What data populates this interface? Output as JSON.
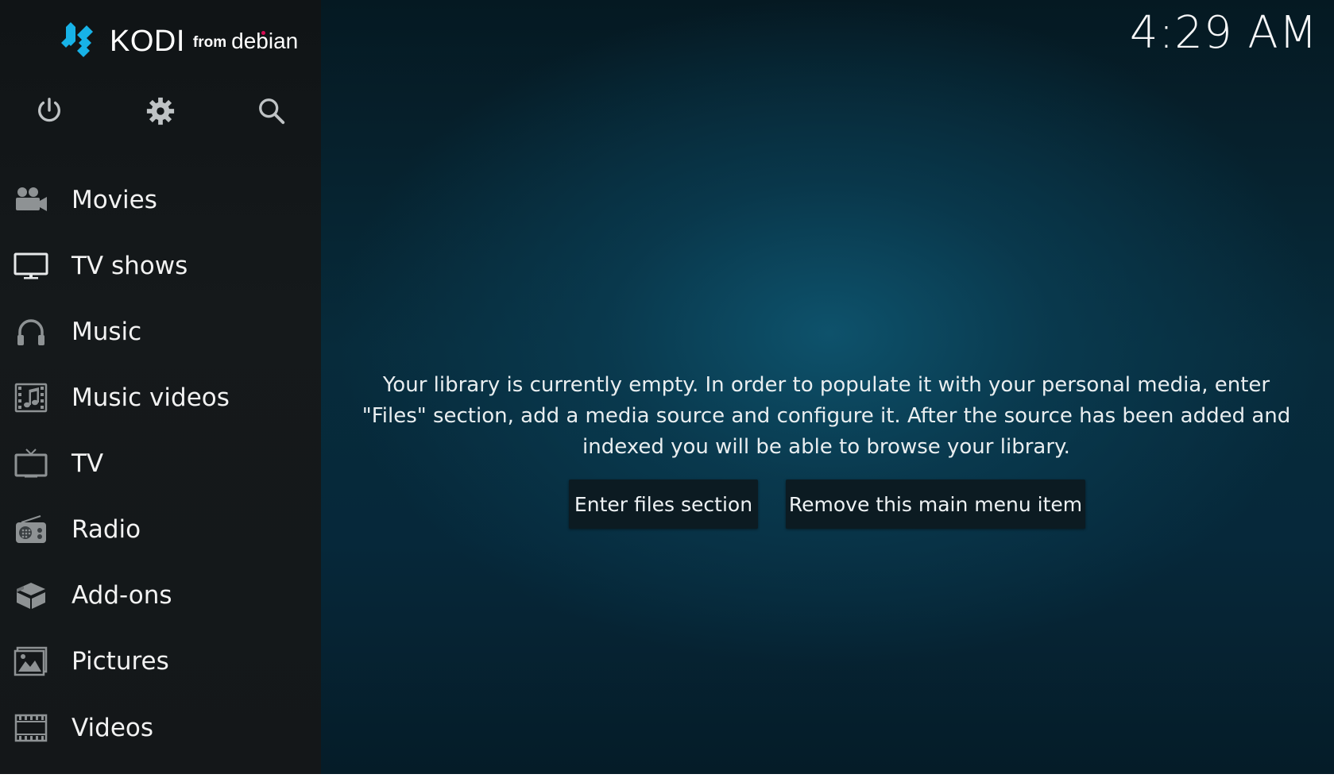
{
  "app": {
    "logo": {
      "brand": "KODI",
      "from": "from",
      "distro": "debian"
    },
    "clock": "4:29 AM"
  },
  "top_icons": [
    {
      "name": "power-icon"
    },
    {
      "name": "gear-icon"
    },
    {
      "name": "search-icon"
    }
  ],
  "sidebar": {
    "items": [
      {
        "label": "Movies",
        "icon": "movie-camera-icon"
      },
      {
        "label": "TV shows",
        "icon": "monitor-icon"
      },
      {
        "label": "Music",
        "icon": "headphones-icon"
      },
      {
        "label": "Music videos",
        "icon": "music-video-icon"
      },
      {
        "label": "TV",
        "icon": "tv-antenna-icon"
      },
      {
        "label": "Radio",
        "icon": "radio-icon"
      },
      {
        "label": "Add-ons",
        "icon": "addons-box-icon"
      },
      {
        "label": "Pictures",
        "icon": "picture-icon"
      },
      {
        "label": "Videos",
        "icon": "film-strip-icon"
      }
    ]
  },
  "main": {
    "message": "Your library is currently empty. In order to populate it with your personal media, enter \"Files\" section, add a media source and configure it. After the source has been added and indexed you will be able to browse your library.",
    "buttons": {
      "enter_files": "Enter files section",
      "remove_item": "Remove this main menu item"
    }
  },
  "colors": {
    "accent": "#17b2e7",
    "sidebar_bg": "#131719",
    "main_bg": "#07324a",
    "button_bg": "#0c1b22",
    "debian_red": "#d70a53"
  }
}
